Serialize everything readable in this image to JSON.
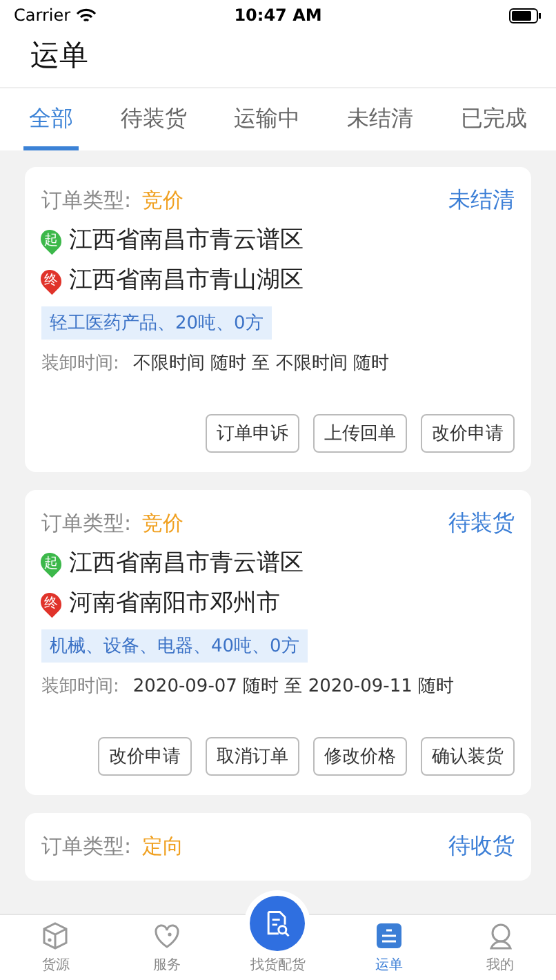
{
  "status_bar": {
    "carrier": "Carrier",
    "time": "10:47 AM"
  },
  "title": "运单",
  "tabs": [
    {
      "label": "全部",
      "selected": true
    },
    {
      "label": "待装货",
      "selected": false
    },
    {
      "label": "运输中",
      "selected": false
    },
    {
      "label": "未结清",
      "selected": false
    },
    {
      "label": "已完成",
      "selected": false
    }
  ],
  "orders": [
    {
      "type_label": "订单类型:",
      "type": "竞价",
      "status": "未结清",
      "from_mark": "起",
      "from": "江西省南昌市青云谱区",
      "to_mark": "终",
      "to": "江西省南昌市青山湖区",
      "cargo": "轻工医药产品、20吨、0方",
      "time_label": "装卸时间:",
      "time": "不限时间 随时 至 不限时间 随时",
      "buttons": [
        "订单申诉",
        "上传回单",
        "改价申请"
      ]
    },
    {
      "type_label": "订单类型:",
      "type": "竞价",
      "status": "待装货",
      "from_mark": "起",
      "from": "江西省南昌市青云谱区",
      "to_mark": "终",
      "to": "河南省南阳市邓州市",
      "cargo": "机械、设备、电器、40吨、0方",
      "time_label": "装卸时间:",
      "time": "2020-09-07 随时 至 2020-09-11 随时",
      "buttons": [
        "改价申请",
        "取消订单",
        "修改价格",
        "确认装货"
      ]
    },
    {
      "type_label": "订单类型:",
      "type": "定向",
      "status": "待收货"
    }
  ],
  "nav": [
    {
      "kind": "box",
      "label": "货源",
      "selected": false
    },
    {
      "kind": "heart",
      "label": "服务",
      "selected": false
    },
    {
      "kind": "search",
      "label": "找货配货",
      "selected": false
    },
    {
      "kind": "list",
      "label": "运单",
      "selected": true
    },
    {
      "kind": "person",
      "label": "我的",
      "selected": false
    }
  ]
}
